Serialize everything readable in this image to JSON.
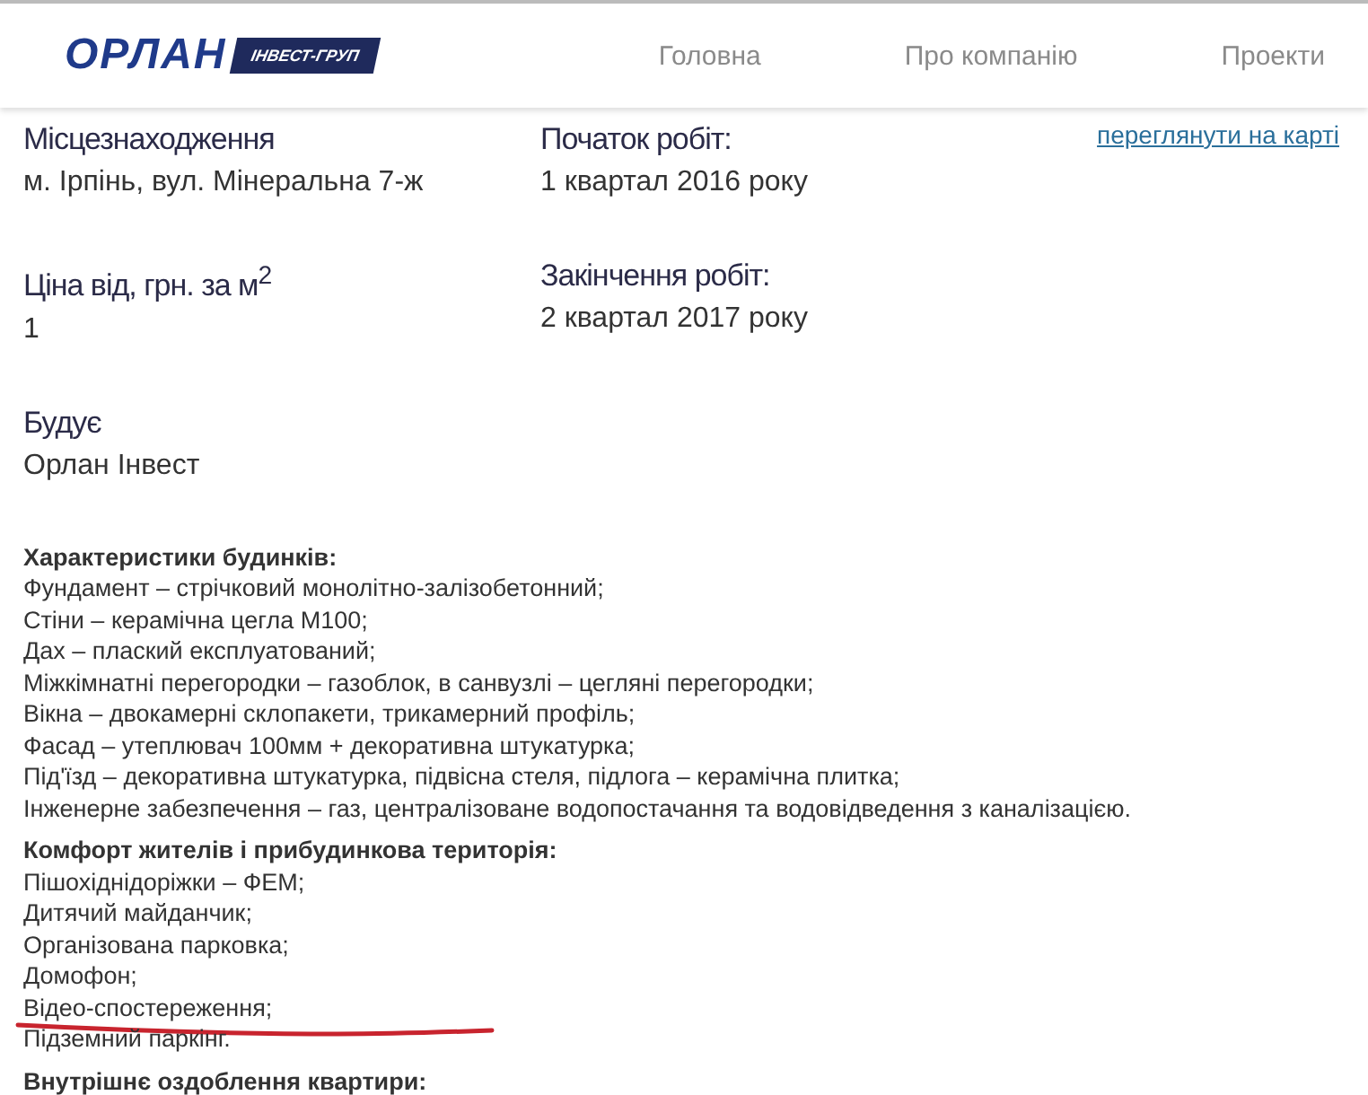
{
  "header": {
    "logo": {
      "name": "ОРЛАН",
      "tag": "ІНВЕСТ-ГРУП"
    },
    "nav": [
      "Головна",
      "Про компанію",
      "Проекти"
    ]
  },
  "map_link": "переглянути на карті",
  "field_rows": [
    [
      {
        "label": "Місцезнаходження",
        "value": "м. Ірпінь, вул. Мінеральна 7-ж"
      },
      {
        "label": "Початок робіт:",
        "value": "1 квартал 2016 року"
      }
    ],
    [
      {
        "label": "Ціна від, грн. за м$^{2}$",
        "value": "1"
      },
      {
        "label": "Закінчення робіт:",
        "value": "2 квартал 2017 року"
      }
    ],
    [
      {
        "label": "Будує",
        "value": "Орлан Інвест"
      }
    ]
  ],
  "sections": [
    {
      "title": "Характеристики будинків:",
      "items": [
        "Фундамент – стрічковий монолітно-залізобетонний;",
        "Стіни – керамічна цегла М100;",
        "Дах – плаский експлуатований;",
        "Міжкімнатні перегородки – газоблок, в санвузлі – цегляні перегородки;",
        "Вікна – двокамерні склопакети, трикамерний профіль;",
        "Фасад – утеплювач 100мм + декоративна штукатурка;",
        "Під'їзд – декоративна штукатурка, підвісна стеля, підлога – керамічна плитка;",
        "Інженерне забезпечення – газ, централізоване водопостачання та водовідведення з каналізацією."
      ]
    },
    {
      "title": "Комфорт жителів і прибудинкова територія:",
      "items": [
        "Пішохіднідоріжки – ФЕМ;",
        "Дитячий майданчик;",
        "Організована парковка;",
        "Домофон;",
        "Відео-спостереження;",
        "Підземний паркінг."
      ]
    },
    {
      "title": "Внутрішнє оздоблення квартири:"
    }
  ]
}
